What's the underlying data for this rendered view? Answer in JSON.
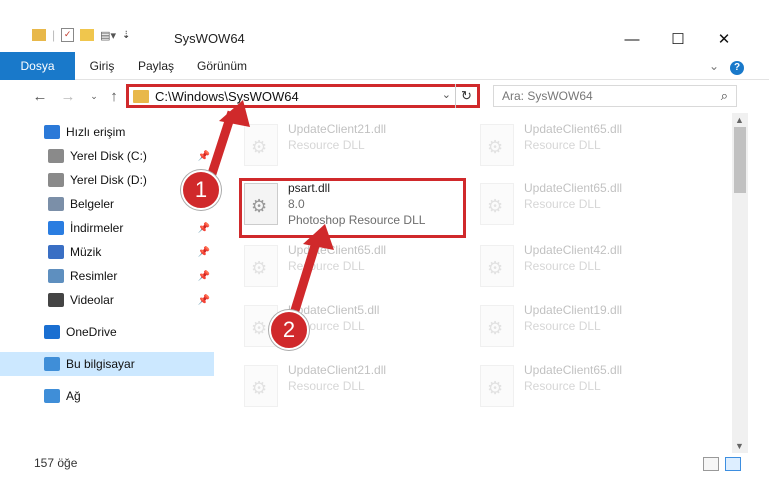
{
  "window": {
    "title": "SysWOW64",
    "minimize": "—",
    "maximize": "☐",
    "close": "✕"
  },
  "ribbon": {
    "tabs": [
      "Dosya",
      "Giriş",
      "Paylaş",
      "Görünüm"
    ],
    "collapse": "⌄",
    "help": "?"
  },
  "address": {
    "path": "C:\\Windows\\SysWOW64",
    "refresh": "↻"
  },
  "search": {
    "placeholder": "Ara: SysWOW64"
  },
  "sidebar": {
    "items": [
      {
        "label": "Hızlı erişim",
        "icon": "star-icon",
        "color": "#2b79d8",
        "pinned": false,
        "indent": 0
      },
      {
        "label": "Yerel Disk (C:)",
        "icon": "drive-icon",
        "color": "#8a8a8a",
        "pinned": true,
        "indent": 1
      },
      {
        "label": "Yerel Disk (D:)",
        "icon": "drive-icon",
        "color": "#8a8a8a",
        "pinned": false,
        "indent": 1
      },
      {
        "label": "Belgeler",
        "icon": "document-icon",
        "color": "#7b8fa8",
        "pinned": true,
        "indent": 1
      },
      {
        "label": "İndirmeler",
        "icon": "download-icon",
        "color": "#2a7de1",
        "pinned": true,
        "indent": 1
      },
      {
        "label": "Müzik",
        "icon": "music-icon",
        "color": "#3a6fc4",
        "pinned": true,
        "indent": 1
      },
      {
        "label": "Resimler",
        "icon": "pictures-icon",
        "color": "#5e8fbf",
        "pinned": true,
        "indent": 1
      },
      {
        "label": "Videolar",
        "icon": "video-icon",
        "color": "#444444",
        "pinned": true,
        "indent": 1
      },
      {
        "label": "OneDrive",
        "icon": "cloud-icon",
        "color": "#1a6fd1",
        "pinned": false,
        "indent": 0
      },
      {
        "label": "Bu bilgisayar",
        "icon": "computer-icon",
        "color": "#3f8ed8",
        "pinned": false,
        "indent": 0,
        "selected": true
      },
      {
        "label": "Ağ",
        "icon": "network-icon",
        "color": "#3f8ed8",
        "pinned": false,
        "indent": 0
      }
    ]
  },
  "files": {
    "highlighted": {
      "name": "psart.dll",
      "version": "8.0",
      "type": "Photoshop Resource DLL"
    },
    "left": [
      {
        "name": "UpdateClient21.dll",
        "type": "Resource DLL"
      },
      {
        "name": "UpdateClient65.dll",
        "type": "Resource DLL"
      },
      {
        "name": "UpdateClient5.dll",
        "type": "Resource DLL"
      },
      {
        "name": "UpdateClient21.dll",
        "type": "Resource DLL"
      }
    ],
    "right": [
      {
        "name": "UpdateClient65.dll",
        "type": "Resource DLL"
      },
      {
        "name": "UpdateClient65.dll",
        "type": "Resource DLL"
      },
      {
        "name": "UpdateClient42.dll",
        "type": "Resource DLL"
      },
      {
        "name": "UpdateClient19.dll",
        "type": "Resource DLL"
      },
      {
        "name": "UpdateClient65.dll",
        "type": "Resource DLL"
      }
    ]
  },
  "annotations": {
    "step1": "1",
    "step2": "2",
    "color": "#d0292b"
  },
  "status": {
    "count": "157 öğe"
  }
}
